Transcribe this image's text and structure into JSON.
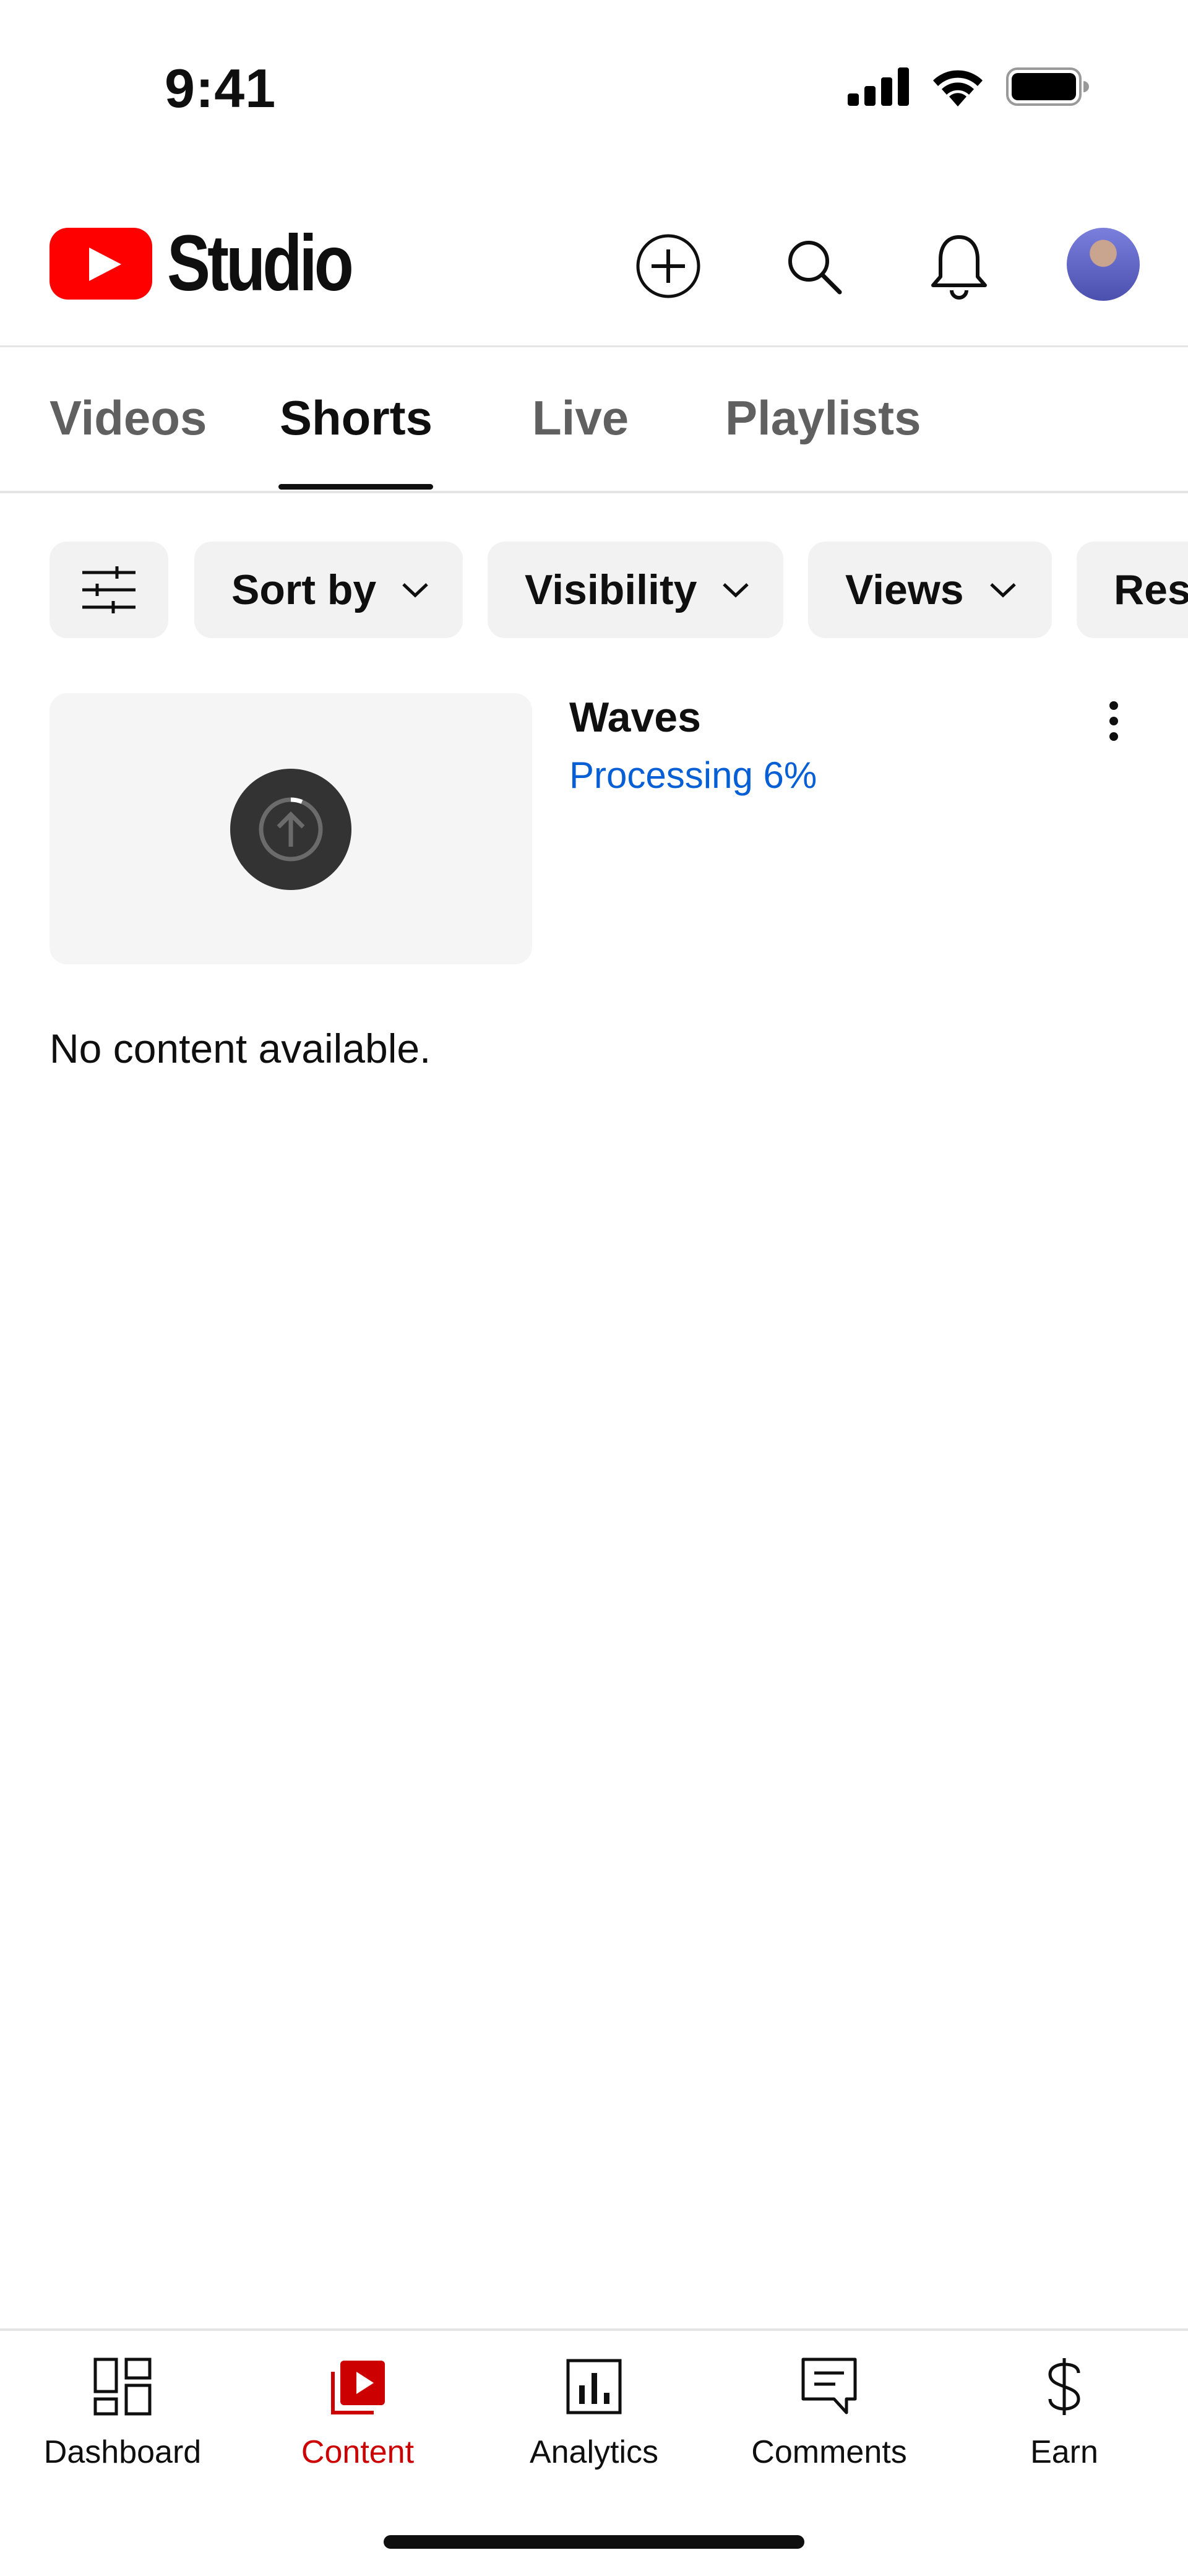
{
  "status_bar": {
    "time": "9:41",
    "icons": [
      "cellular-signal-icon",
      "wifi-icon",
      "battery-icon"
    ]
  },
  "header": {
    "logo_text": "Studio",
    "brand_color": "#ff0000",
    "icons": [
      "create-plus-icon",
      "search-icon",
      "notifications-bell-icon",
      "avatar"
    ]
  },
  "tabs": {
    "items": [
      {
        "label": "Videos",
        "active": false
      },
      {
        "label": "Shorts",
        "active": true
      },
      {
        "label": "Live",
        "active": false
      },
      {
        "label": "Playlists",
        "active": false
      }
    ]
  },
  "filters": {
    "filter_icon": "sliders-filter-icon",
    "chips": [
      {
        "label": "Sort by"
      },
      {
        "label": "Visibility"
      },
      {
        "label": "Views"
      },
      {
        "label": "Res"
      }
    ]
  },
  "content": {
    "item": {
      "title": "Waves",
      "status": "Processing 6%",
      "progress_percent": 6,
      "status_color": "#065fd4"
    },
    "empty_message": "No content available."
  },
  "bottom_nav": {
    "active_color": "#cc0000",
    "items": [
      {
        "label": "Dashboard",
        "icon": "dashboard-icon",
        "active": false
      },
      {
        "label": "Content",
        "icon": "content-icon",
        "active": true
      },
      {
        "label": "Analytics",
        "icon": "analytics-icon",
        "active": false
      },
      {
        "label": "Comments",
        "icon": "comments-icon",
        "active": false
      },
      {
        "label": "Earn",
        "icon": "earn-dollar-icon",
        "active": false
      }
    ]
  }
}
